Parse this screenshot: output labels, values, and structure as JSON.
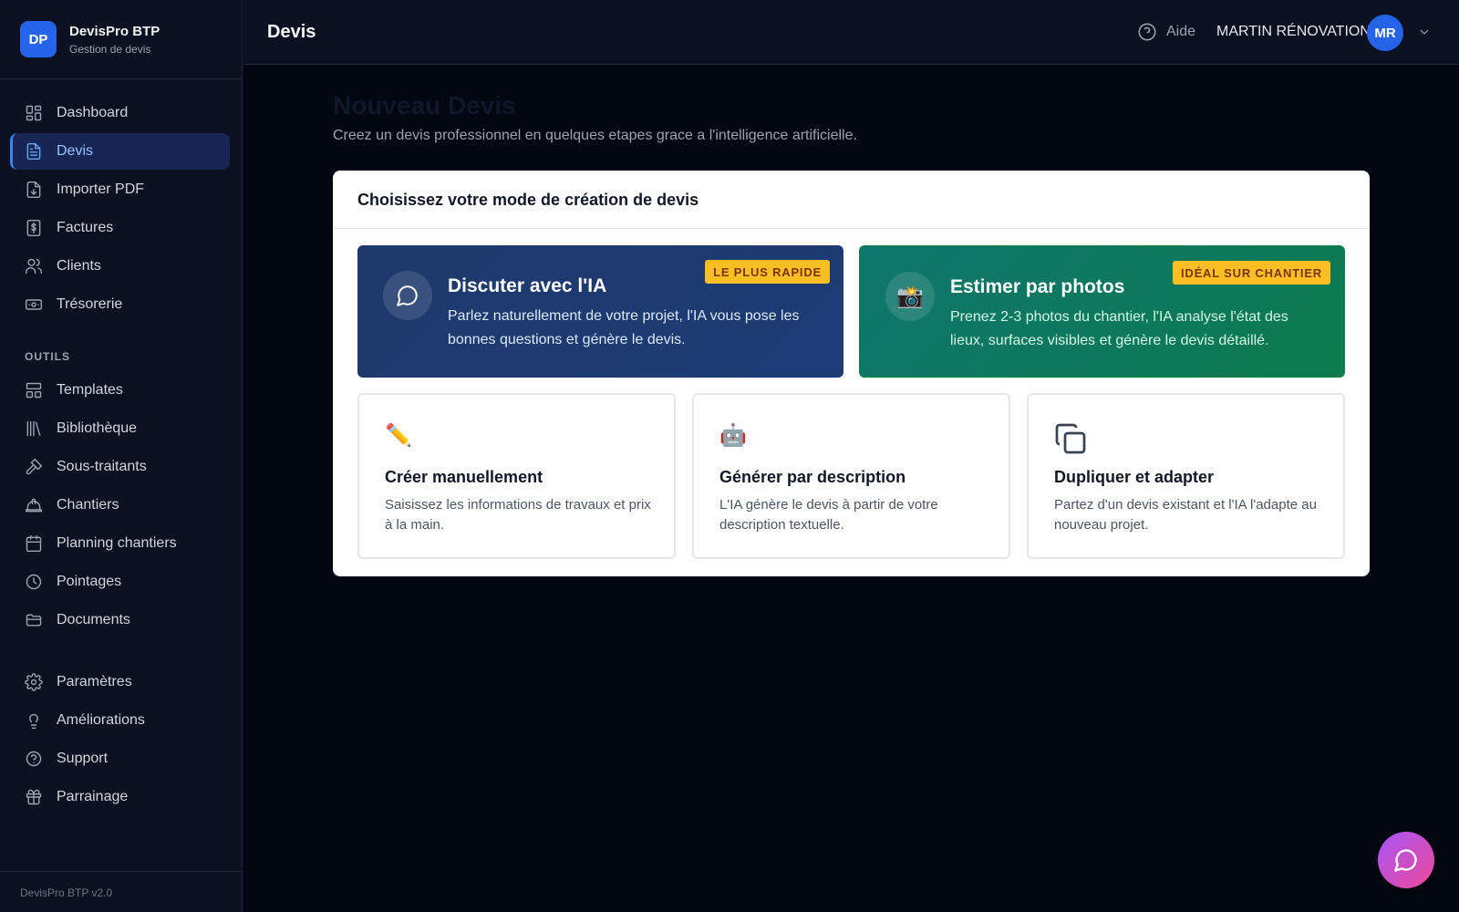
{
  "brand": {
    "logo": "DP",
    "name": "DevisPro BTP",
    "subtitle": "Gestion de devis"
  },
  "sidebar": {
    "main_items": [
      {
        "label": "Dashboard",
        "icon": "dashboard-icon"
      },
      {
        "label": "Devis",
        "icon": "document-icon",
        "active": true
      },
      {
        "label": "Importer PDF",
        "icon": "file-import-icon"
      },
      {
        "label": "Factures",
        "icon": "invoice-icon"
      },
      {
        "label": "Clients",
        "icon": "users-icon"
      },
      {
        "label": "Trésorerie",
        "icon": "banknote-icon"
      }
    ],
    "tools_label": "OUTILS",
    "tools_items": [
      {
        "label": "Templates",
        "icon": "template-icon"
      },
      {
        "label": "Bibliothèque",
        "icon": "library-icon"
      },
      {
        "label": "Sous-traitants",
        "icon": "hammer-icon"
      },
      {
        "label": "Chantiers",
        "icon": "hardhat-icon"
      },
      {
        "label": "Planning chantiers",
        "icon": "calendar-icon"
      },
      {
        "label": "Pointages",
        "icon": "clock-icon"
      },
      {
        "label": "Documents",
        "icon": "folder-icon"
      }
    ],
    "bottom_items": [
      {
        "label": "Paramètres",
        "icon": "gear-icon"
      },
      {
        "label": "Améliorations",
        "icon": "lightbulb-icon"
      },
      {
        "label": "Support",
        "icon": "help-circle-icon"
      },
      {
        "label": "Parrainage",
        "icon": "gift-icon"
      }
    ],
    "footer": "DevisPro BTP v2.0"
  },
  "header": {
    "title": "Devis",
    "help_label": "Aide",
    "company": "MARTIN RÉNOVATION",
    "avatar_initials": "MR"
  },
  "main": {
    "title": "Nouveau Devis",
    "subtitle": "Creez un devis professionnel en quelques etapes grace a l'intelligence artificielle.",
    "panel_title": "Choisissez votre mode de création de devis",
    "featured_modes": [
      {
        "title": "Discuter avec l'IA",
        "description": "Parlez naturellement de votre projet, l'IA vous pose les bonnes questions et génère le devis.",
        "badge": "LE PLUS RAPIDE",
        "icon": "chat-bubble-icon",
        "color": "#1e3a6b"
      },
      {
        "title": "Estimer par photos",
        "description": "Prenez 2-3 photos du chantier, l'IA analyse l'état des lieux, surfaces visibles et génère le devis détaillé.",
        "badge": "IDÉAL SUR CHANTIER",
        "icon": "camera-flash-icon",
        "glyph": "📸",
        "color": "#0b7a4d"
      }
    ],
    "other_modes": [
      {
        "title": "Créer manuellement",
        "description": "Saisissez les informations de travaux et prix à la main.",
        "icon": "pencil-icon",
        "glyph": "✏️"
      },
      {
        "title": "Générer par description",
        "description": "L'IA génère le devis à partir de votre description textuelle.",
        "icon": "robot-icon",
        "glyph": "🤖"
      },
      {
        "title": "Dupliquer et adapter",
        "description": "Partez d'un devis existant et l'IA l'adapte au nouveau projet.",
        "icon": "copy-icon"
      }
    ]
  },
  "fab": {
    "icon": "chat-bubble-icon"
  }
}
